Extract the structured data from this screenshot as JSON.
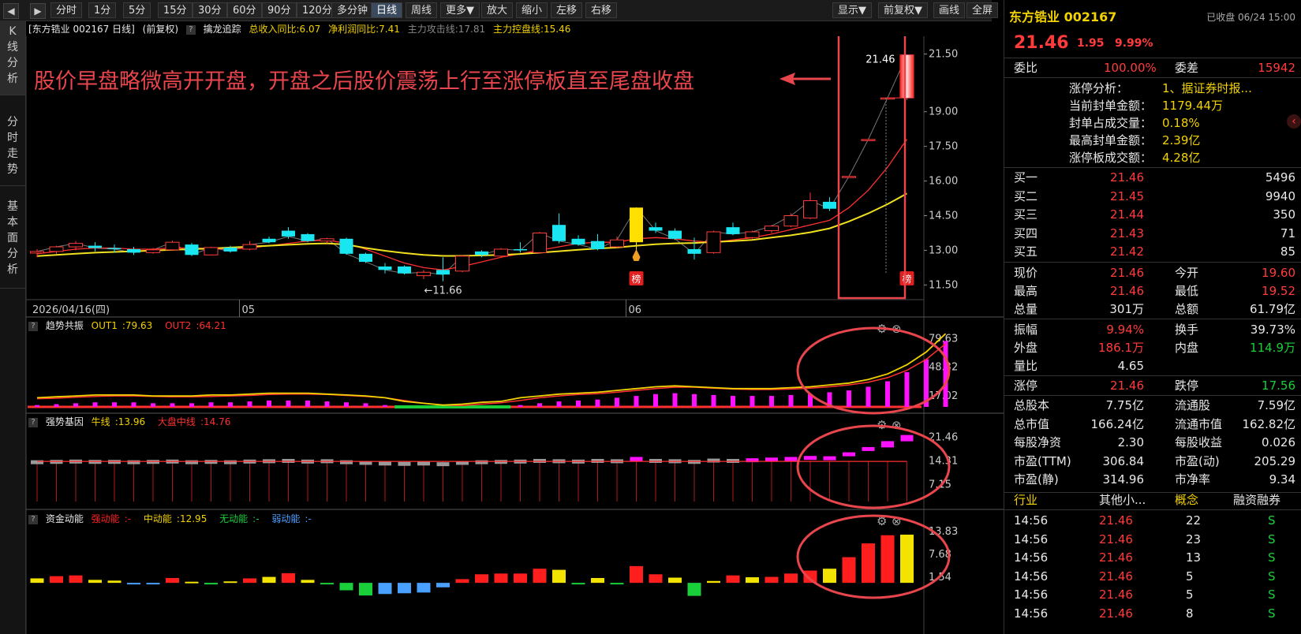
{
  "toolbar": {
    "nav_prev": "◀",
    "nav_next": "▶",
    "periods": [
      "分时",
      "1分",
      "5分",
      "15分",
      "30分",
      "60分",
      "90分",
      "120分",
      "多分钟",
      "日线",
      "周线",
      "更多▼"
    ],
    "active_period": "日线",
    "actions": [
      "放大",
      "缩小",
      "左移",
      "右移"
    ],
    "right_actions": [
      "显示▼",
      "前复权▼",
      "画线",
      "全屏"
    ]
  },
  "rail": {
    "tabs": [
      "K线分析",
      "分时走势",
      "基本面分析"
    ],
    "active": "K线分析"
  },
  "main_header": {
    "title": "[东方锆业 002167 日线]",
    "adjust": "(前复权)",
    "indicator_name": "擒龙追踪",
    "fields": [
      {
        "label": "总收入同比:6.07",
        "color": "#f2d200"
      },
      {
        "label": "净利润同比:7.41",
        "color": "#f2d200"
      },
      {
        "label": "主力攻击线:17.81",
        "color": "#888888"
      },
      {
        "label": "主力控盘线:15.46",
        "color": "#f2d200"
      }
    ]
  },
  "annotation": "股价早盘略微高开开盘，开盘之后股价震荡上行至涨停板直至尾盘收盘",
  "date_axis": {
    "first_date": "2026/04/16(四)",
    "months": [
      "05",
      "06"
    ],
    "month_index": [
      11,
      31
    ]
  },
  "chart_data": [
    {
      "type": "candlestick",
      "name": "日线",
      "ylim": [
        11.0,
        22.2
      ],
      "yticks": [
        11.5,
        13.0,
        14.5,
        16.0,
        17.5,
        19.0,
        21.5
      ],
      "candles": [
        {
          "o": 12.88,
          "h": 13.05,
          "l": 12.7,
          "c": 12.95
        },
        {
          "o": 12.95,
          "h": 13.2,
          "l": 12.85,
          "c": 13.15
        },
        {
          "o": 13.15,
          "h": 13.4,
          "l": 13.0,
          "c": 13.3
        },
        {
          "o": 13.2,
          "h": 13.35,
          "l": 12.95,
          "c": 13.1
        },
        {
          "o": 13.1,
          "h": 13.25,
          "l": 12.9,
          "c": 13.05
        },
        {
          "o": 13.05,
          "h": 13.15,
          "l": 12.8,
          "c": 12.9
        },
        {
          "o": 12.9,
          "h": 13.1,
          "l": 12.85,
          "c": 13.02
        },
        {
          "o": 13.02,
          "h": 13.42,
          "l": 12.98,
          "c": 13.35
        },
        {
          "o": 13.25,
          "h": 13.32,
          "l": 12.75,
          "c": 12.8
        },
        {
          "o": 12.8,
          "h": 13.15,
          "l": 12.78,
          "c": 13.12
        },
        {
          "o": 13.12,
          "h": 13.2,
          "l": 12.9,
          "c": 12.95
        },
        {
          "o": 13.05,
          "h": 13.4,
          "l": 13.0,
          "c": 13.25
        },
        {
          "o": 13.5,
          "h": 13.6,
          "l": 13.3,
          "c": 13.35
        },
        {
          "o": 13.85,
          "h": 14.0,
          "l": 13.5,
          "c": 13.6
        },
        {
          "o": 13.7,
          "h": 13.75,
          "l": 13.35,
          "c": 13.4
        },
        {
          "o": 13.4,
          "h": 13.55,
          "l": 13.3,
          "c": 13.5
        },
        {
          "o": 13.5,
          "h": 13.55,
          "l": 12.8,
          "c": 12.85
        },
        {
          "o": 12.85,
          "h": 12.9,
          "l": 12.45,
          "c": 12.5
        },
        {
          "o": 12.3,
          "h": 12.45,
          "l": 12.0,
          "c": 12.15
        },
        {
          "o": 12.3,
          "h": 12.35,
          "l": 11.95,
          "c": 12.0
        },
        {
          "o": 11.9,
          "h": 12.15,
          "l": 11.75,
          "c": 12.05
        },
        {
          "o": 12.15,
          "h": 12.7,
          "l": 11.66,
          "c": 11.95
        },
        {
          "o": 12.1,
          "h": 12.8,
          "l": 12.05,
          "c": 12.75
        },
        {
          "o": 12.95,
          "h": 13.0,
          "l": 12.7,
          "c": 12.8
        },
        {
          "o": 12.75,
          "h": 13.1,
          "l": 12.7,
          "c": 13.05
        },
        {
          "o": 13.05,
          "h": 13.35,
          "l": 12.9,
          "c": 13.0
        },
        {
          "o": 12.9,
          "h": 13.8,
          "l": 12.85,
          "c": 13.75
        },
        {
          "o": 14.1,
          "h": 14.6,
          "l": 13.3,
          "c": 13.4
        },
        {
          "o": 13.5,
          "h": 13.65,
          "l": 13.2,
          "c": 13.25
        },
        {
          "o": 13.4,
          "h": 13.7,
          "l": 13.0,
          "c": 13.05
        },
        {
          "o": 13.15,
          "h": 13.6,
          "l": 13.1,
          "c": 13.45
        },
        {
          "o": 13.35,
          "h": 14.85,
          "l": 12.95,
          "c": 14.85
        },
        {
          "o": 14.0,
          "h": 14.2,
          "l": 13.75,
          "c": 13.85
        },
        {
          "o": 13.85,
          "h": 13.95,
          "l": 13.45,
          "c": 13.5
        },
        {
          "o": 13.05,
          "h": 13.55,
          "l": 12.6,
          "c": 12.85
        },
        {
          "o": 12.9,
          "h": 13.85,
          "l": 12.85,
          "c": 13.8
        },
        {
          "o": 14.0,
          "h": 14.2,
          "l": 13.65,
          "c": 13.7
        },
        {
          "o": 13.55,
          "h": 13.85,
          "l": 13.5,
          "c": 13.8
        },
        {
          "o": 13.85,
          "h": 14.1,
          "l": 13.75,
          "c": 14.05
        },
        {
          "o": 14.05,
          "h": 14.6,
          "l": 14.0,
          "c": 14.5
        },
        {
          "o": 14.4,
          "h": 15.5,
          "l": 14.35,
          "c": 15.15
        },
        {
          "o": 15.1,
          "h": 15.3,
          "l": 14.7,
          "c": 14.8
        },
        {
          "o": 16.2,
          "h": 16.2,
          "l": 16.2,
          "c": 16.2
        },
        {
          "o": 17.8,
          "h": 17.8,
          "l": 17.8,
          "c": 17.8
        },
        {
          "o": 19.6,
          "h": 19.6,
          "l": 19.6,
          "c": 19.6
        },
        {
          "o": 19.6,
          "h": 21.46,
          "l": 19.52,
          "c": 21.46
        }
      ],
      "special_candles": [
        {
          "index": 31,
          "color": "#ffe000"
        }
      ],
      "ma_fast": {
        "name": "主力攻击线",
        "value": 17.81,
        "color": "#ff3030",
        "values": [
          12.85,
          12.95,
          13.05,
          13.1,
          13.1,
          13.05,
          13.05,
          13.1,
          13.1,
          13.08,
          13.05,
          13.1,
          13.2,
          13.3,
          13.4,
          13.45,
          13.3,
          13.05,
          12.75,
          12.45,
          12.25,
          12.15,
          12.3,
          12.5,
          12.7,
          12.85,
          13.0,
          13.15,
          13.3,
          13.35,
          13.35,
          13.5,
          13.55,
          13.5,
          13.4,
          13.35,
          13.45,
          13.55,
          13.7,
          13.9,
          14.1,
          14.3,
          14.85,
          15.6,
          16.6,
          17.81
        ]
      },
      "ma_slow": {
        "name": "主力控盘线",
        "value": 15.46,
        "color": "#f0e020",
        "values": [
          12.75,
          12.8,
          12.85,
          12.9,
          12.93,
          12.96,
          12.99,
          13.02,
          13.05,
          13.08,
          13.12,
          13.16,
          13.2,
          13.24,
          13.28,
          13.3,
          13.25,
          13.1,
          12.98,
          12.88,
          12.8,
          12.76,
          12.76,
          12.78,
          12.8,
          12.84,
          12.9,
          12.96,
          13.02,
          13.08,
          13.12,
          13.2,
          13.26,
          13.3,
          13.32,
          13.36,
          13.4,
          13.45,
          13.55,
          13.65,
          13.78,
          13.95,
          14.25,
          14.6,
          15.0,
          15.46
        ]
      },
      "low_marker": "11.66",
      "price_flag": "21.46",
      "badge_text": "榜",
      "badge_indices": [
        31,
        45
      ],
      "rocket_index": 31
    },
    {
      "type": "line",
      "name": "趋势共振",
      "series": [
        {
          "name": "OUT1",
          "value": 79.63,
          "color": "#f2d200"
        },
        {
          "name": "OUT2",
          "value": 64.21,
          "color": "#ff3030"
        }
      ],
      "ylim": [
        5,
        86
      ],
      "yticks": [
        17.02,
        48.32,
        79.63
      ],
      "bars": [
        2,
        3,
        4,
        5,
        5,
        5,
        4,
        4,
        4,
        5,
        5,
        6,
        7,
        7,
        7,
        6,
        5,
        4,
        2,
        -2,
        -4,
        -6,
        -5,
        -3,
        -2,
        2,
        4,
        6,
        7,
        8,
        10,
        12,
        14,
        15,
        14,
        13,
        12,
        12,
        12,
        13,
        14,
        16,
        18,
        22,
        28,
        38,
        52,
        72
      ]
    },
    {
      "type": "bar",
      "name": "强势基因",
      "series": [
        {
          "name": "牛线",
          "value": 13.96,
          "color": "#f2d200"
        },
        {
          "name": "大盘中线",
          "value": 14.76,
          "color": "#ff3030"
        }
      ],
      "ylim": [
        2,
        24
      ],
      "yticks": [
        7.15,
        14.31,
        21.46
      ],
      "values": [
        13.8,
        13.9,
        14.0,
        13.9,
        13.9,
        13.8,
        13.9,
        14.0,
        13.8,
        13.9,
        13.8,
        14.0,
        14.1,
        14.2,
        14.0,
        14.1,
        13.8,
        13.6,
        13.4,
        13.3,
        13.4,
        13.2,
        13.6,
        13.8,
        13.9,
        14.0,
        14.2,
        14.1,
        14.0,
        14.2,
        14.1,
        14.8,
        14.2,
        14.1,
        13.9,
        14.3,
        14.2,
        14.4,
        14.6,
        14.8,
        15.1,
        15.0,
        16.2,
        17.8,
        19.6,
        21.46
      ]
    },
    {
      "type": "bar",
      "name": "资金动能",
      "series": [
        {
          "name": "强动能",
          "value": "-",
          "color": "#ff2020"
        },
        {
          "name": "中动能",
          "value": 12.95,
          "color": "#f2d200"
        },
        {
          "name": "无动能",
          "value": "-",
          "color": "#19d03a"
        },
        {
          "name": "弱动能",
          "value": "-",
          "color": "#4aa0ff"
        }
      ],
      "ylim": [
        -4,
        15.5
      ],
      "yticks": [
        1.54,
        7.68,
        13.83
      ],
      "values": [
        1.2,
        1.8,
        2.0,
        0.8,
        0.6,
        -0.3,
        -0.4,
        1.3,
        0.3,
        -0.2,
        0.4,
        1.2,
        1.6,
        2.6,
        0.8,
        -0.3,
        -2.0,
        -3.4,
        -3.0,
        -2.8,
        -2.6,
        -1.2,
        1.0,
        2.3,
        2.5,
        2.5,
        3.8,
        3.5,
        -0.3,
        1.3,
        -0.4,
        4.5,
        2.3,
        1.4,
        -3.5,
        0.5,
        2.0,
        1.5,
        1.6,
        2.5,
        3.3,
        3.8,
        6.9,
        10.6,
        12.8,
        12.95
      ],
      "colors": [
        "y",
        "r",
        "r",
        "y",
        "y",
        "b",
        "b",
        "r",
        "y",
        "g",
        "y",
        "r",
        "y",
        "r",
        "y",
        "g",
        "g",
        "g",
        "b",
        "b",
        "b",
        "b",
        "r",
        "r",
        "r",
        "r",
        "r",
        "y",
        "g",
        "y",
        "g",
        "r",
        "r",
        "y",
        "g",
        "y",
        "r",
        "y",
        "r",
        "r",
        "r",
        "y",
        "r",
        "r",
        "r",
        "y"
      ]
    }
  ],
  "panel": {
    "stock_name": "东方锆业 002167",
    "status": "已收盘 06/24 15:00",
    "price": "21.46",
    "change": "1.95",
    "change_pct": "9.99%",
    "weibi_label": "委比",
    "weibi": "100.00%",
    "weicha_label": "委差",
    "weicha": "15942",
    "limit_rows": [
      {
        "label": "涨停分析：",
        "value": "1、据证券时报..."
      },
      {
        "label": "当前封单金额：",
        "value": "1179.44万"
      },
      {
        "label": "封单占成交量：",
        "value": "0.18%"
      },
      {
        "label": "最高封单金额：",
        "value": "2.39亿"
      },
      {
        "label": "涨停板成交额：",
        "value": "4.28亿"
      }
    ],
    "bids": [
      {
        "label": "买一",
        "price": "21.46",
        "vol": "5496"
      },
      {
        "label": "买二",
        "price": "21.45",
        "vol": "9940"
      },
      {
        "label": "买三",
        "price": "21.44",
        "vol": "350"
      },
      {
        "label": "买四",
        "price": "21.43",
        "vol": "71"
      },
      {
        "label": "买五",
        "price": "21.42",
        "vol": "85"
      }
    ],
    "quote_rows": [
      {
        "l1": "现价",
        "v1": "21.46",
        "c1": "red",
        "l2": "今开",
        "v2": "19.60",
        "c2": "red"
      },
      {
        "l1": "最高",
        "v1": "21.46",
        "c1": "red",
        "l2": "最低",
        "v2": "19.52",
        "c2": "red"
      },
      {
        "l1": "总量",
        "v1": "301万",
        "c1": "white",
        "l2": "总额",
        "v2": "61.79亿",
        "c2": "white"
      }
    ],
    "stat_rows": [
      {
        "l1": "振幅",
        "v1": "9.94%",
        "c1": "red",
        "l2": "换手",
        "v2": "39.73%",
        "c2": "white"
      },
      {
        "l1": "外盘",
        "v1": "186.1万",
        "c1": "red",
        "l2": "内盘",
        "v2": "114.9万",
        "c2": "green"
      },
      {
        "l1": "量比",
        "v1": "4.65",
        "c1": "white",
        "l2": "",
        "v2": "",
        "c2": "white"
      }
    ],
    "limit_prices": {
      "l1": "涨停",
      "v1": "21.46",
      "l2": "跌停",
      "v2": "17.56"
    },
    "fund_rows": [
      {
        "l1": "总股本",
        "v1": "7.75亿",
        "l2": "流通股",
        "v2": "7.59亿"
      },
      {
        "l1": "总市值",
        "v1": "166.24亿",
        "l2": "流通市值",
        "v2": "162.82亿"
      },
      {
        "l1": "每股净资",
        "v1": "2.30",
        "l2": "每股收益",
        "v2": "0.026"
      },
      {
        "l1": "市盈(TTM)",
        "v1": "306.84",
        "l2": "市盈(动)",
        "v2": "205.29"
      },
      {
        "l1": "市盈(静)",
        "v1": "314.96",
        "l2": "市净率",
        "v2": "9.34"
      }
    ],
    "tags": {
      "industry_label": "行业",
      "industry": "其他小...",
      "concept_label": "概念",
      "margin_label": "融资融券"
    },
    "trades": [
      {
        "time": "14:56",
        "price": "21.46",
        "vol": "22",
        "side": "S"
      },
      {
        "time": "14:56",
        "price": "21.46",
        "vol": "23",
        "side": "S"
      },
      {
        "time": "14:56",
        "price": "21.46",
        "vol": "13",
        "side": "S"
      },
      {
        "time": "14:56",
        "price": "21.46",
        "vol": "5",
        "side": "S"
      },
      {
        "time": "14:56",
        "price": "21.46",
        "vol": "5",
        "side": "S"
      },
      {
        "time": "14:56",
        "price": "21.46",
        "vol": "8",
        "side": "S"
      }
    ],
    "collapse_icon": "‹"
  },
  "colors": {
    "up": "#ff3b3b",
    "down": "#19e6f0",
    "yellow": "#f2d200",
    "magenta": "#ff10ff",
    "green": "#19d03a",
    "blue": "#4aa0ff",
    "grey": "#9a9a9a",
    "circle": "#e8464c"
  }
}
